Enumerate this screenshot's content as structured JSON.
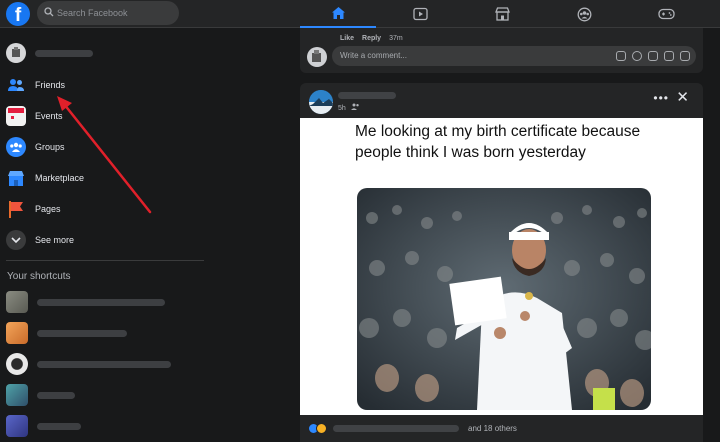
{
  "topbar": {
    "search_placeholder": "Search Facebook",
    "nav_tabs": [
      "home-icon",
      "watch-icon",
      "marketplace-icon",
      "groups-icon",
      "gaming-icon"
    ],
    "active_tab": "home-icon",
    "accent": "#2d88ff"
  },
  "sidebar": {
    "items": [
      {
        "label": "Friends",
        "icon": "friends-icon"
      },
      {
        "label": "Events",
        "icon": "events-icon"
      },
      {
        "label": "Groups",
        "icon": "groups-icon"
      },
      {
        "label": "Marketplace",
        "icon": "marketplace-icon"
      },
      {
        "label": "Pages",
        "icon": "pages-icon"
      },
      {
        "label": "See more",
        "icon": "chevron-down-icon"
      }
    ],
    "shortcuts_title": "Your shortcuts"
  },
  "comment_box": {
    "like_label": "Like",
    "reply_label": "Reply",
    "time": "37m",
    "placeholder": "Write a comment..."
  },
  "post": {
    "time": "5h",
    "meme_caption": "Me looking at my birth certificate because people think I was born yesterday",
    "reactions_suffix": "and 18 others"
  },
  "annotation": {
    "arrow_color": "#e0202a",
    "points_to": "Friends"
  }
}
